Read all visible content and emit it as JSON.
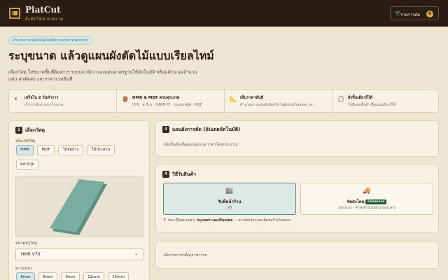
{
  "header": {
    "brand_name": "PlatCut",
    "brand_tagline": "สั่งตัดไม้ตามขนาด",
    "order_button_label": "รายการตัด",
    "order_count": "0"
  },
  "hero": {
    "pill": "คำนวณราคาตัดไม้อัตโนมัติจากแผ่นมาตรฐานจริง",
    "title": "ระบุขนาด แล้วดูแผนผังตัดไม้แบบเรียลไทม์",
    "subtitle": "เลือกวัสดุ ใส่ขนาดชิ้นที่ต้องการ ระบบจะจัดวางลงแผ่นมาตรฐานให้อัตโนมัติ พร้อมคำนวณจำนวนแผ่น ค่าตัดส่ง และราคารวมทันที"
  },
  "features": [
    {
      "icon": "bolt-icon",
      "glyph": "⚡",
      "title": "เสร็จใน 2 วันทำการ",
      "desc": "เร็วกว่าสั่งตรงจากโรงงาน"
    },
    {
      "icon": "stack-icon",
      "glyph": "🪵",
      "title": "HMR & MDF ครบทุกเกรด",
      "desc": "V70 · อะไกร · CARB P2 · ทนเหลพลิต · MDF"
    },
    {
      "icon": "ruler-icon",
      "glyph": "📐",
      "title": "เห็นราคาทันที",
      "desc": "คำนวณจากแผนผังตัดจริง ไม่ต้องรอใบเสนอราคา"
    },
    {
      "icon": "clipboard-icon",
      "glyph": "📋",
      "title": "สั่งชิ้นเดียวก็ได้",
      "desc": "ไม่มียอดขั้นต่ำ ซื้อแผ่นเดียวก็ได้"
    }
  ],
  "material": {
    "step": "1",
    "title": "เลือกวัสดุ",
    "type_label": "ประเภทวัสดุ",
    "types": [
      {
        "label": "HMR",
        "active": true
      },
      {
        "label": "MDF",
        "active": false
      },
      {
        "label": "ไม้อัดยาง",
        "active": false
      },
      {
        "label": "ไม้ประสาน",
        "active": false
      },
      {
        "label": "พลายวูด",
        "active": false
      }
    ],
    "preview_colors": {
      "board": "#79ad9f",
      "board_edge": "#5e8f82"
    },
    "grade_label": "ขนาดหรูวัสดุ",
    "grade_value": "HMR V70",
    "thickness_label": "ความหนา",
    "thickness": [
      {
        "label": "6mm",
        "active": true
      },
      {
        "label": "6mm",
        "active": false
      },
      {
        "label": "9mm",
        "active": false
      },
      {
        "label": "12mm",
        "active": false
      },
      {
        "label": "15mm",
        "active": false
      }
    ]
  },
  "layout": {
    "step": "3",
    "title": "แผนผังการตัด (อัปเดตอัตโนมัติ)",
    "note": "เพิ่มชิ้นตัดเพื่อดูแผนผังและราคาโดยประมาณ"
  },
  "delivery": {
    "step": "4",
    "title": "วิธีรับสินค้า",
    "options": [
      {
        "icon": "store-icon",
        "glyph": "🏬",
        "title": "รับที่หน้าร้าน",
        "sub": "ฟรี",
        "active": true
      },
      {
        "icon": "truck-icon",
        "glyph": "🚚",
        "title": "จัดส่งโดย",
        "badge": "Lalamove",
        "sub": "รถกระบะ · ค่าส่งคำนวณตามระยะทาง",
        "active": false
      }
    ],
    "note_prefix": "ขณะนี้จัดส่งเฉพาะ",
    "note_bold": "กรุงเทพฯ และปริมณฑล",
    "note_suffix": "— ต่างจังหวัดกรุณาติดต่อร้านโดยตรง"
  },
  "summary": {
    "note": "เพิ่มรายการเพื่อดูราคารวม"
  },
  "colors": {
    "topbar": "#2b1d14",
    "accent": "#d9a84a",
    "background": "#efe5d3",
    "card": "#f7f0e3",
    "active_teal": "#d8e7e7"
  }
}
